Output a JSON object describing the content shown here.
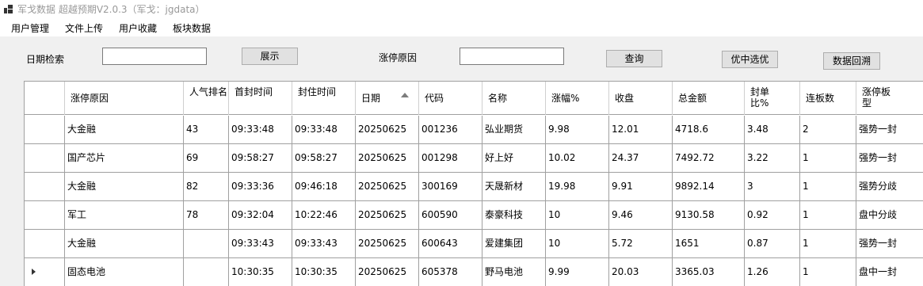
{
  "window": {
    "title": "军戈数据 超越预期V2.0.3（军戈：jgdata）"
  },
  "menu": [
    "用户管理",
    "文件上传",
    "用户收藏",
    "板块数据"
  ],
  "search": {
    "date_label": "日期检索",
    "date_value": "",
    "show_button": "展示",
    "reason_label": "涨停原因",
    "reason_value": "",
    "query_button": "查询",
    "select_button": "优中选优",
    "backtrack_button": "数据回溯"
  },
  "table": {
    "columns": [
      "涨停原因",
      "人气排名",
      "首封时间",
      "封住时间",
      "日期",
      "代码",
      "名称",
      "涨幅%",
      "收盘",
      "总金额",
      "封单比%",
      "连板数",
      "涨停板型"
    ],
    "sort_column": "日期",
    "rows": [
      [
        "大金融",
        "43",
        "09:33:48",
        "09:33:48",
        "20250625",
        "001236",
        "弘业期货",
        "9.98",
        "12.01",
        "4718.6",
        "3.48",
        "2",
        "强势一封"
      ],
      [
        "国产芯片",
        "69",
        "09:58:27",
        "09:58:27",
        "20250625",
        "001298",
        "好上好",
        "10.02",
        "24.37",
        "7492.72",
        "3.22",
        "1",
        "强势一封"
      ],
      [
        "大金融",
        "82",
        "09:33:36",
        "09:46:18",
        "20250625",
        "300169",
        "天晟新材",
        "19.98",
        "9.91",
        "9892.14",
        "3",
        "1",
        "强势分歧"
      ],
      [
        "军工",
        "78",
        "09:32:04",
        "10:22:46",
        "20250625",
        "600590",
        "泰豪科技",
        "10",
        "9.46",
        "9130.58",
        "0.92",
        "1",
        "盘中分歧"
      ],
      [
        "大金融",
        "",
        "09:33:43",
        "09:33:43",
        "20250625",
        "600643",
        "爱建集团",
        "10",
        "5.72",
        "1651",
        "0.87",
        "1",
        "强势一封"
      ],
      [
        "固态电池",
        "",
        "10:30:35",
        "10:30:35",
        "20250625",
        "605378",
        "野马电池",
        "9.99",
        "20.03",
        "3365.03",
        "1.26",
        "1",
        "盘中一封"
      ]
    ],
    "current_row": 5
  }
}
